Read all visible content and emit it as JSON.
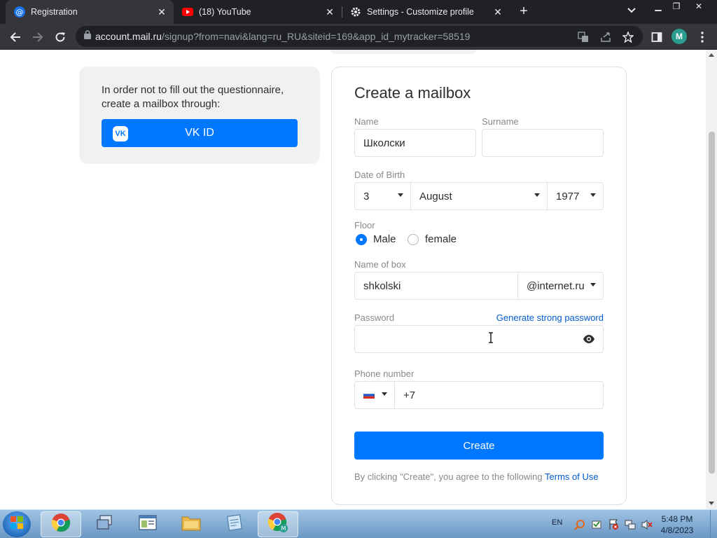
{
  "browser": {
    "tabs": [
      {
        "title": "Registration",
        "active": true
      },
      {
        "title": "(18) YouTube",
        "active": false
      },
      {
        "title": "Settings - Customize profile",
        "active": false
      }
    ],
    "url_host": "account.mail.ru",
    "url_path": "/signup?from=navi&lang=ru_RU&siteid=169&app_id_mytracker=58519",
    "profile_initial": "M"
  },
  "sidebar": {
    "hint": "In order not to fill out the questionnaire, create a mailbox through:",
    "vk_button": "VK ID",
    "vk_logo": "VK"
  },
  "form": {
    "title": "Create a mailbox",
    "name": {
      "label": "Name",
      "value": "Школски"
    },
    "surname": {
      "label": "Surname",
      "value": ""
    },
    "dob": {
      "label": "Date of Birth",
      "day": "3",
      "month": "August",
      "year": "1977"
    },
    "floor": {
      "label": "Floor",
      "options": [
        "Male",
        "female"
      ],
      "selected": "Male"
    },
    "mailbox": {
      "label": "Name of box",
      "value": "shkolski",
      "domain": "@internet.ru"
    },
    "password": {
      "label": "Password",
      "value": "",
      "generate_link": "Generate strong password"
    },
    "phone": {
      "label": "Phone number",
      "prefix": "+7",
      "country": "RU"
    },
    "create_button": "Create",
    "terms_text": "By clicking \"Create\", you agree to the following",
    "terms_link": "Terms of Use"
  },
  "taskbar": {
    "lang": "EN",
    "time": "5:48 PM",
    "date": "4/8/2023"
  },
  "colors": {
    "accent": "#0077ff",
    "link": "#005bd1",
    "chrome_dark": "#202124",
    "chrome_toolbar": "#35363a"
  }
}
